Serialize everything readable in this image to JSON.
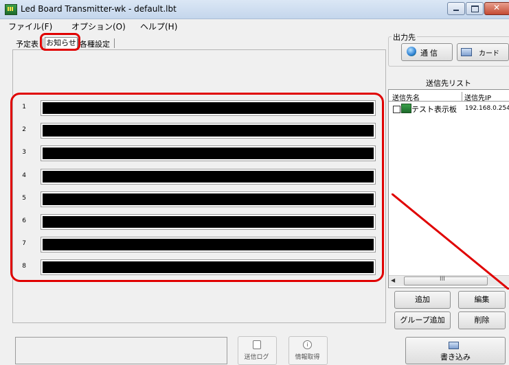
{
  "window": {
    "title": "Led Board Transmitter-wk - default.lbt"
  },
  "menu": [
    "ファイル(F)",
    "オプション(O)",
    "ヘルプ(H)"
  ],
  "tabs": [
    "予定表",
    "お知らせ",
    "各種設定"
  ],
  "message_rows": [
    {
      "number": "1",
      "value": ""
    },
    {
      "number": "2",
      "value": ""
    },
    {
      "number": "3",
      "value": ""
    },
    {
      "number": "4",
      "value": ""
    },
    {
      "number": "5",
      "value": ""
    },
    {
      "number": "6",
      "value": ""
    },
    {
      "number": "7",
      "value": ""
    },
    {
      "number": "8",
      "value": ""
    }
  ],
  "output": {
    "group_title": "出力先",
    "tsushin_label": "通信",
    "card_label": "カード"
  },
  "destination_list": {
    "title": "送信先リスト",
    "columns": [
      "送信先名",
      "送信先IP"
    ],
    "rows": [
      {
        "name": "テスト表示板",
        "ip": "192.168.0.254",
        "checked": false
      }
    ],
    "scroll_grip": "III"
  },
  "buttons": {
    "add": "追加",
    "edit": "編集",
    "group_add": "グループ追加",
    "delete": "削除",
    "send_log": "送信ログ",
    "info_get": "情報取得",
    "write": "書き込み"
  },
  "colors": {
    "highlight": "#e00000",
    "row_fill": "#000000"
  }
}
